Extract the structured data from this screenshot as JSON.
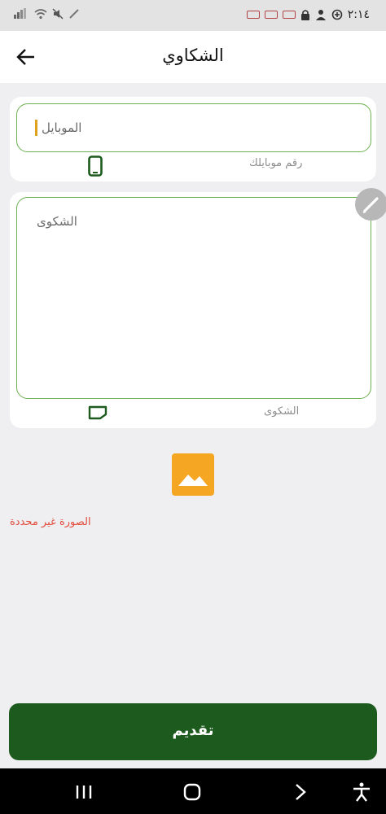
{
  "status_bar": {
    "time": "٢:١٤",
    "left_icons": [
      "signal-icon",
      "wifi-icon",
      "mute-icon",
      "pen-icon"
    ],
    "right_icons": [
      "notification-icon",
      "notification-icon",
      "notification-icon",
      "lock-icon",
      "user-icon",
      "sync-icon"
    ]
  },
  "app_bar": {
    "title": "الشكاوي",
    "back_icon": "arrow-left-icon"
  },
  "form": {
    "mobile": {
      "placeholder": "الموبايل",
      "hint": "رقم موبايلك",
      "icon": "phone-icon"
    },
    "complaint": {
      "placeholder": "الشكوى",
      "hint": "الشكوى",
      "icon": "note-icon"
    },
    "edit_icon": "pencil-icon",
    "image_icon": "image-icon",
    "image_error": "الصورة غير محددة",
    "submit_label": "تقديم"
  },
  "nav_bar": {
    "icons": [
      "recents-icon",
      "home-icon",
      "back-icon",
      "accessibility-icon"
    ]
  },
  "colors": {
    "primary": "#1c5a1e",
    "field_border": "#6cb04f",
    "accent": "#f5a623",
    "error": "#e14b3b"
  }
}
